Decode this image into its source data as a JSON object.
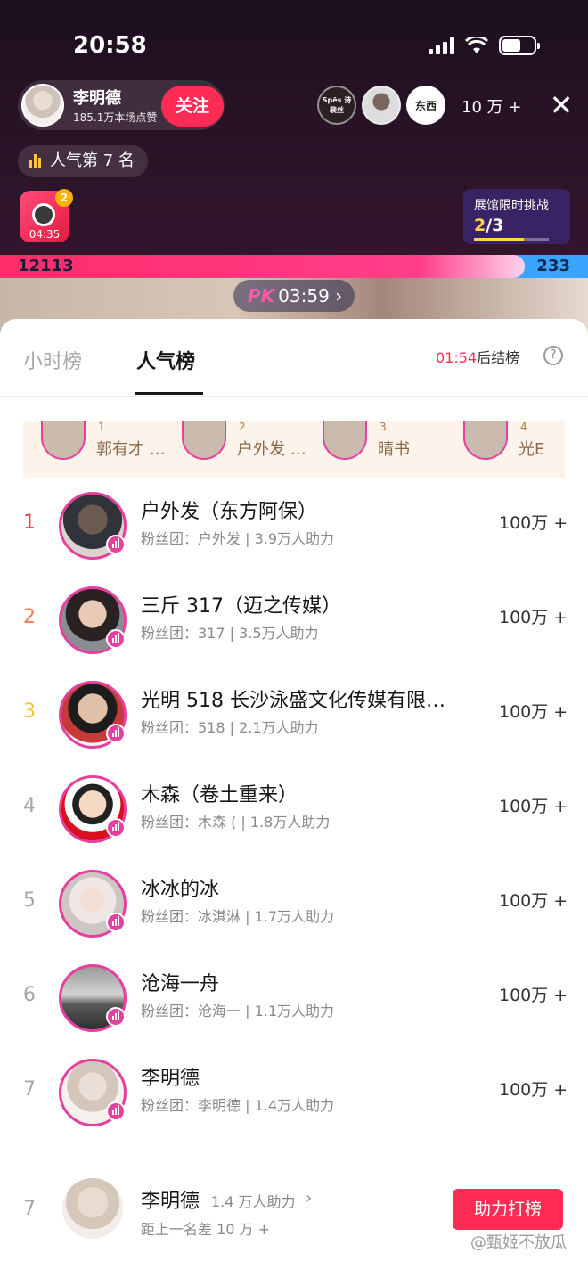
{
  "status_bar": {
    "time": "20:58"
  },
  "live": {
    "host_name": "李明德",
    "host_sub": "185.1万本场点赞",
    "follow_label": "关注",
    "viewers": [
      {
        "label": "Spēs 诗裴丝",
        "icon": "brand-logo"
      },
      {
        "label": "",
        "icon": "viewer-avatar"
      },
      {
        "label": "东西",
        "icon": "brand-logo"
      }
    ],
    "viewer_count": "10 万 +",
    "popularity_rank": "人气第 7 名",
    "gift_badge": "2",
    "gift_timer": "04:35",
    "challenge_title": "展馆限时挑战",
    "challenge_progress_current": "2",
    "challenge_progress_total": "/3",
    "challenge_fraction": 0.6667,
    "pk_left_score": "12113",
    "pk_right_score": "233",
    "pk_left_share": 0.893,
    "pk_label": "PK",
    "pk_timer": "03:59",
    "pk_chevron": "›"
  },
  "tabs": [
    {
      "label": "小时榜",
      "active": false
    },
    {
      "label": "人气榜",
      "active": true
    }
  ],
  "countdown": {
    "time": "01:54",
    "suffix": "后结榜",
    "help_icon": "question-circle-icon"
  },
  "contributors": [
    {
      "num": "1",
      "name": "郭有才 …"
    },
    {
      "num": "2",
      "name": "户外发 …"
    },
    {
      "num": "3",
      "name": "晴书"
    },
    {
      "num": "4",
      "name": "光E"
    }
  ],
  "rankings": [
    {
      "rank": "1",
      "name": "户外发（东方阿保）",
      "sub": "粉丝团：户外发 | 3.9万人助力",
      "score": "100万 +"
    },
    {
      "rank": "2",
      "name": "三斤 317（迈之传媒）",
      "sub": "粉丝团：317 | 3.5万人助力",
      "score": "100万 +"
    },
    {
      "rank": "3",
      "name": "光明 518 长沙泳盛文化传媒有限…",
      "sub": "粉丝团：518 | 2.1万人助力",
      "score": "100万 +"
    },
    {
      "rank": "4",
      "name": "木森（卷土重来）",
      "sub": "粉丝团：木森 ( | 1.8万人助力",
      "score": "100万 +"
    },
    {
      "rank": "5",
      "name": "冰冰的冰",
      "sub": "粉丝团：冰淇淋 | 1.7万人助力",
      "score": "100万 +"
    },
    {
      "rank": "6",
      "name": "沧海一舟",
      "sub": "粉丝团：沧海一 | 1.1万人助力",
      "score": "100万 +"
    },
    {
      "rank": "7",
      "name": "李明德",
      "sub": "粉丝团：李明德 | 1.4万人助力",
      "score": "100万 +"
    }
  ],
  "me": {
    "rank": "7",
    "name": "李明德",
    "help": "1.4 万人助力",
    "chevron": "›",
    "gap": "距上一名差 10 万 +",
    "button": "助力打榜"
  },
  "watermark": "@甄姬不放瓜",
  "colors": {
    "accent": "#fe2c55",
    "pk_blue": "#3aa4ff",
    "ring": "#e6409e"
  }
}
